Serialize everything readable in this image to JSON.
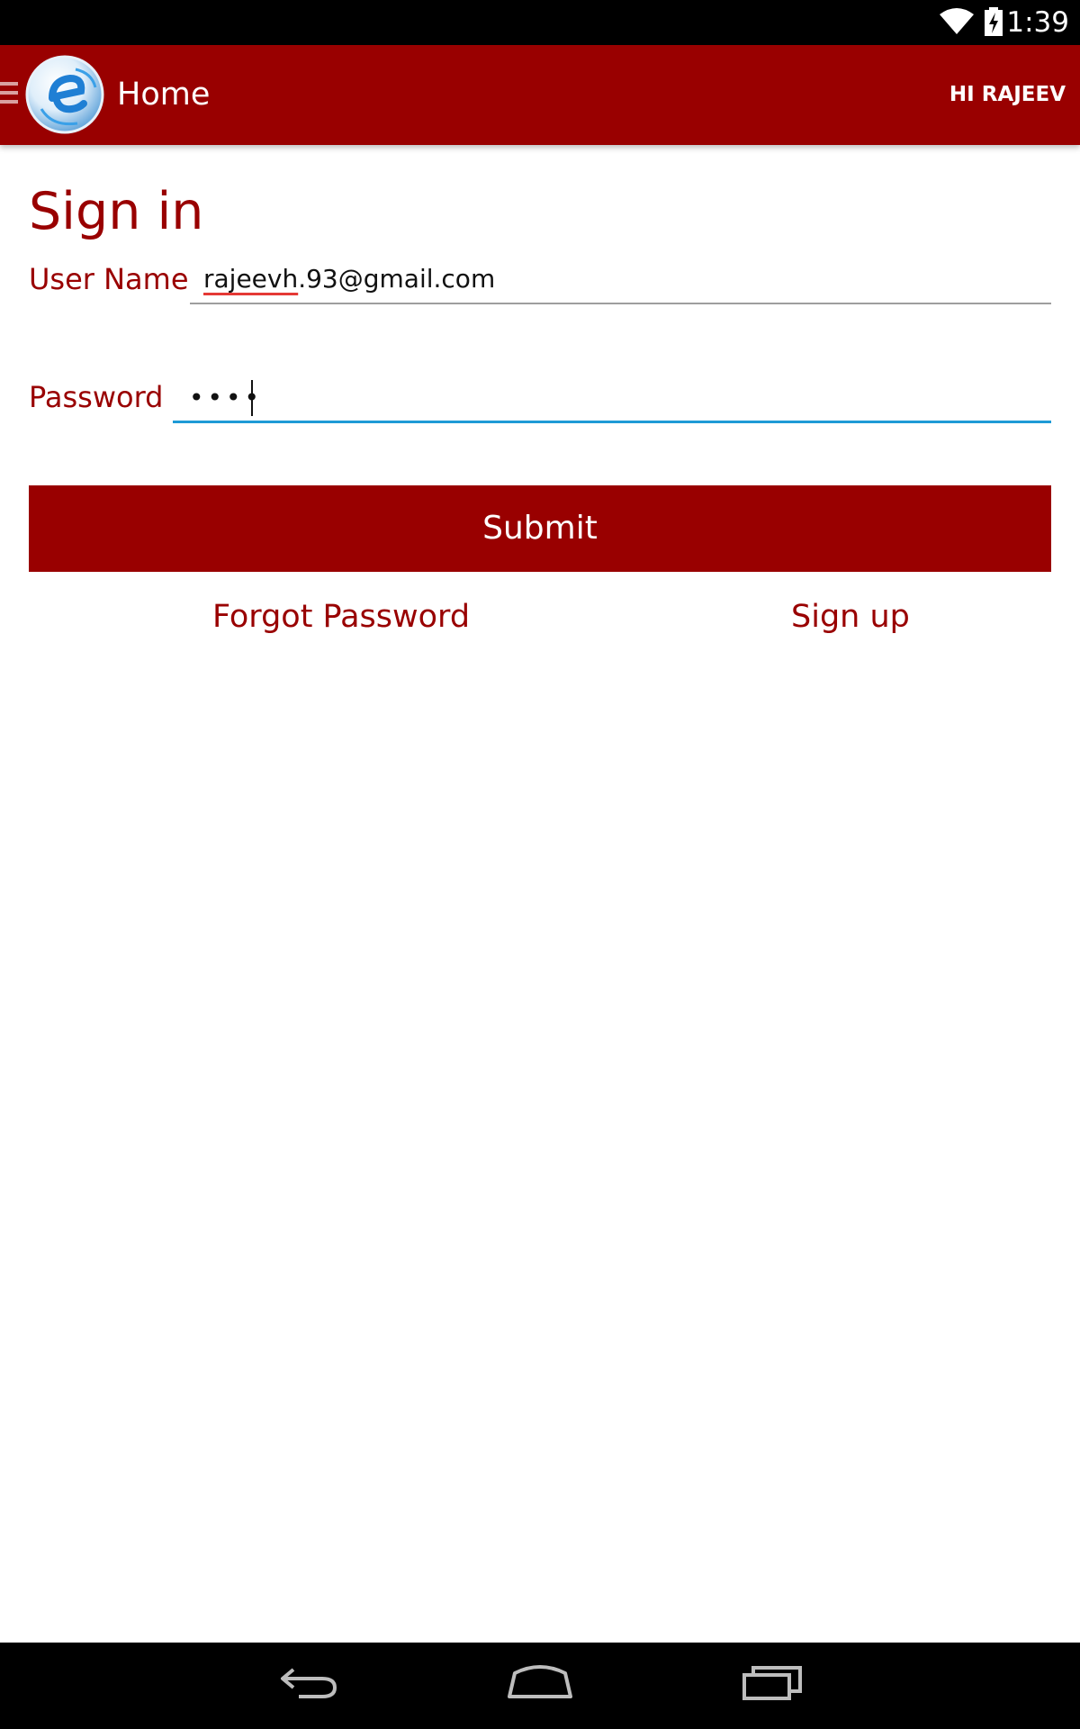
{
  "status_bar": {
    "time": "1:39",
    "wifi_icon": "wifi-icon",
    "battery_icon": "battery-charging-icon"
  },
  "app_bar": {
    "menu_icon": "hamburger-menu-icon",
    "logo_icon": "e-logo-icon",
    "title": "Home",
    "greeting": "HI RAJEEV",
    "color": "#990000"
  },
  "form": {
    "heading": "Sign in",
    "username_label": "User Name",
    "username_value_spellcheck": "rajeevh",
    "username_value_rest": ".93@gmail.com",
    "password_label": "Password",
    "password_value": "••••",
    "submit_label": "Submit",
    "forgot_password": "Forgot Password",
    "sign_up": "Sign up"
  },
  "nav_bar": {
    "back_icon": "back-icon",
    "home_icon": "home-icon",
    "recents_icon": "recents-icon"
  }
}
